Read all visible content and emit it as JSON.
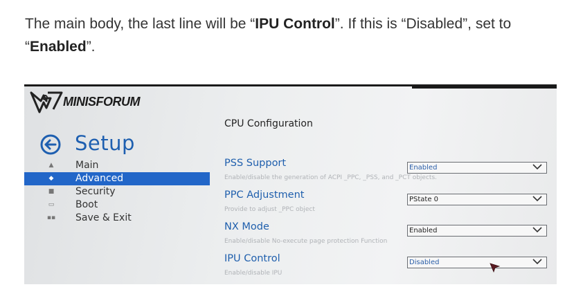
{
  "article": {
    "part1": "The main body, the last line will be “",
    "bold1": "IPU Control",
    "part2": "”. If this is “Disabled”, set to “",
    "bold2": "Enabled",
    "part3": "”."
  },
  "bios": {
    "brand": "MINISFORUM",
    "setup_title": "Setup",
    "section_title": "CPU Configuration",
    "nav": [
      {
        "label": "Main",
        "icon": "main-icon"
      },
      {
        "label": "Advanced",
        "icon": "advanced-icon",
        "active": true
      },
      {
        "label": "Security",
        "icon": "security-icon"
      },
      {
        "label": "Boot",
        "icon": "boot-icon"
      },
      {
        "label": "Save & Exit",
        "icon": "save-exit-icon"
      }
    ],
    "options": [
      {
        "label": "PSS Support",
        "help": "Enable/disable the generation of ACPI _PPC, _PSS, and _PCT objects.",
        "value": "Enabled"
      },
      {
        "label": "PPC Adjustment",
        "help": "Provide to adjust _PPC object",
        "value": "PState 0"
      },
      {
        "label": "NX Mode",
        "help": "Enable/disable No-execute page protection Function",
        "value": "Enabled"
      },
      {
        "label": "IPU Control",
        "help": "Enable/disable IPU",
        "value": "Disabled"
      }
    ],
    "colors": {
      "accent": "#2266c8",
      "option_label": "#1f5fad",
      "setup_title": "#1e5fb0"
    }
  }
}
